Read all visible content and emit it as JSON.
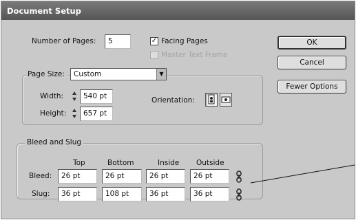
{
  "window": {
    "title": "Document Setup"
  },
  "pages": {
    "label": "Number of Pages:",
    "value": "5",
    "facing_label": "Facing Pages",
    "facing_checked": true,
    "master_label": "Master Text Frame",
    "master_checked": false
  },
  "buttons": {
    "ok": "OK",
    "cancel": "Cancel",
    "fewer": "Fewer Options"
  },
  "page_size": {
    "label": "Page Size:",
    "value": "Custom",
    "width_label": "Width:",
    "width_value": "540 pt",
    "height_label": "Height:",
    "height_value": "657 pt",
    "orientation_label": "Orientation:"
  },
  "bleed_slug": {
    "title": "Bleed and Slug",
    "columns": [
      "Top",
      "Bottom",
      "Inside",
      "Outside"
    ],
    "rows": [
      {
        "label": "Bleed:",
        "values": [
          "26 pt",
          "26 pt",
          "26 pt",
          "26 pt"
        ]
      },
      {
        "label": "Slug:",
        "values": [
          "36 pt",
          "108 pt",
          "36 pt",
          "36 pt"
        ]
      }
    ]
  },
  "colors": {
    "dialog": "#c9c9c9",
    "titlebar": "#5a5a5a",
    "field": "#ffffff"
  }
}
